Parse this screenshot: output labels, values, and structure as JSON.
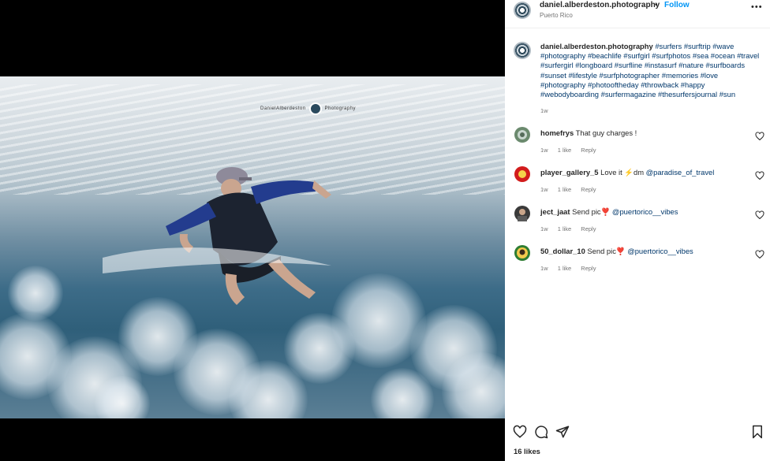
{
  "post": {
    "username": "daniel.alberdeston.photography",
    "dot": "•",
    "follow_label": "Follow",
    "location": "Puerto Rico",
    "more_label": "•••",
    "watermark_left": "DanielAlberdeston",
    "watermark_right": "Photography"
  },
  "caption": {
    "username": "daniel.alberdeston.photography",
    "hashtags": "#surfers #surftrip #wave #photography #beachlife #surfgirl #surfphotos #sea #ocean #travel #surfergirl #longboard #surfline #instasurf #nature #surfboards #sunset #lifestyle #surfphotographer #memories #love #photography #photooftheday #throwback #happy #webodyboarding #surfermagazine #thesurfersjournal #sun",
    "time": "1w"
  },
  "comments": [
    {
      "username": "homefrys",
      "text": "That guy charges !",
      "mention": "",
      "time": "1w",
      "likes": "1 like",
      "reply": "Reply"
    },
    {
      "username": "player_gallery_5",
      "text": "Love it ⚡️dm",
      "mention": "@paradise_of_travel",
      "time": "1w",
      "likes": "1 like",
      "reply": "Reply"
    },
    {
      "username": "ject_jaat",
      "text": "Send pic❣️",
      "mention": "@puertorico__vibes",
      "time": "1w",
      "likes": "1 like",
      "reply": "Reply"
    },
    {
      "username": "50_dollar_10",
      "text": "Send pic❣️",
      "mention": "@puertorico__vibes",
      "time": "1w",
      "likes": "1 like",
      "reply": "Reply"
    }
  ],
  "likes_count": "16 likes",
  "colors": {
    "link": "#0095f6",
    "hashtag": "#00376b",
    "muted": "#737373"
  }
}
